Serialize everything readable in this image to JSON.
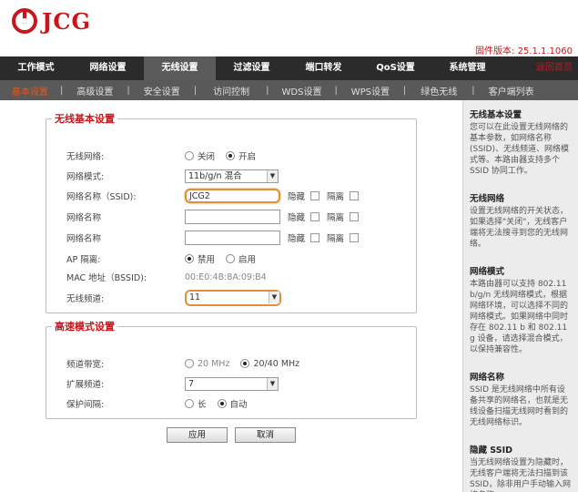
{
  "brand": {
    "name": "JCG",
    "color": "#c8161d"
  },
  "firmware": "固件版本: 25.1.1.1060",
  "main_nav": {
    "tabs": [
      "工作模式",
      "网络设置",
      "无线设置",
      "过滤设置",
      "端口转发",
      "QoS设置",
      "系统管理"
    ],
    "active": "无线设置",
    "home": "返回首页"
  },
  "sub_nav": {
    "items": [
      "基本设置",
      "高级设置",
      "安全设置",
      "访问控制",
      "WDS设置",
      "WPS设置",
      "绿色无线",
      "客户端列表"
    ],
    "active": "基本设置"
  },
  "basic": {
    "legend": "无线基本设置",
    "wireless_label": "无线网络:",
    "wireless_off": "关闭",
    "wireless_on": "开启",
    "wireless_value": "开启",
    "mode_label": "网络模式:",
    "mode_value": "11b/g/n 混合",
    "ssid_label": "网络名称（SSID):",
    "ssid_value": "JCG2",
    "name_label_2": "网络名称",
    "name_label_3": "网络名称",
    "hide_label": "隐藏",
    "isolate_label": "隔离",
    "ap_isolation_label": "AP 隔离:",
    "ap_disable": "禁用",
    "ap_enable": "启用",
    "ap_value": "禁用",
    "mac_label": "MAC 地址（BSSID):",
    "mac_value": "00:E0:4B:8A:09:B4",
    "channel_label": "无线频道:",
    "channel_value": "11"
  },
  "high": {
    "legend": "高速模式设置",
    "bandwidth_label": "频道带宽:",
    "bw_20": "20 MHz",
    "bw_2040": "20/40 MHz",
    "bandwidth_value": "20/40 MHz",
    "ext_label": "扩展频道:",
    "ext_value": "7",
    "guard_label": "保护间隔:",
    "guard_long": "长",
    "guard_auto": "自动",
    "guard_value": "自动"
  },
  "buttons": {
    "apply": "应用",
    "cancel": "取消"
  },
  "help": [
    {
      "title": "无线基本设置",
      "text": "您可以在此设置无线网络的基本参数，如网络名称(SSID)、无线频道、网络模式等。本路由器支持多个SSID 协同工作。"
    },
    {
      "title": "无线网络",
      "text": "设置无线网络的开关状态，如果选择\"关闭\"，无线客户端将无法搜寻到您的无线网络。"
    },
    {
      "title": "网络模式",
      "text": "本路由器可以支持 802.11 b/g/n 无线网络模式，根据网络环境，可以选择不同的网络模式。如果网络中同时存在 802.11 b 和 802.11 g 设备，请选择混合模式，以保持兼容性。"
    },
    {
      "title": "网络名称",
      "text": "SSID 是无线网络中所有设备共享的网络名，也就是无线设备扫描无线网时看到的无线网络标识。"
    },
    {
      "title": "隐藏 SSID",
      "text": "当无线网络设置为隐藏时，无线客户端将无法扫描到该 SSID，除非用户手动输入网络名称。"
    }
  ]
}
